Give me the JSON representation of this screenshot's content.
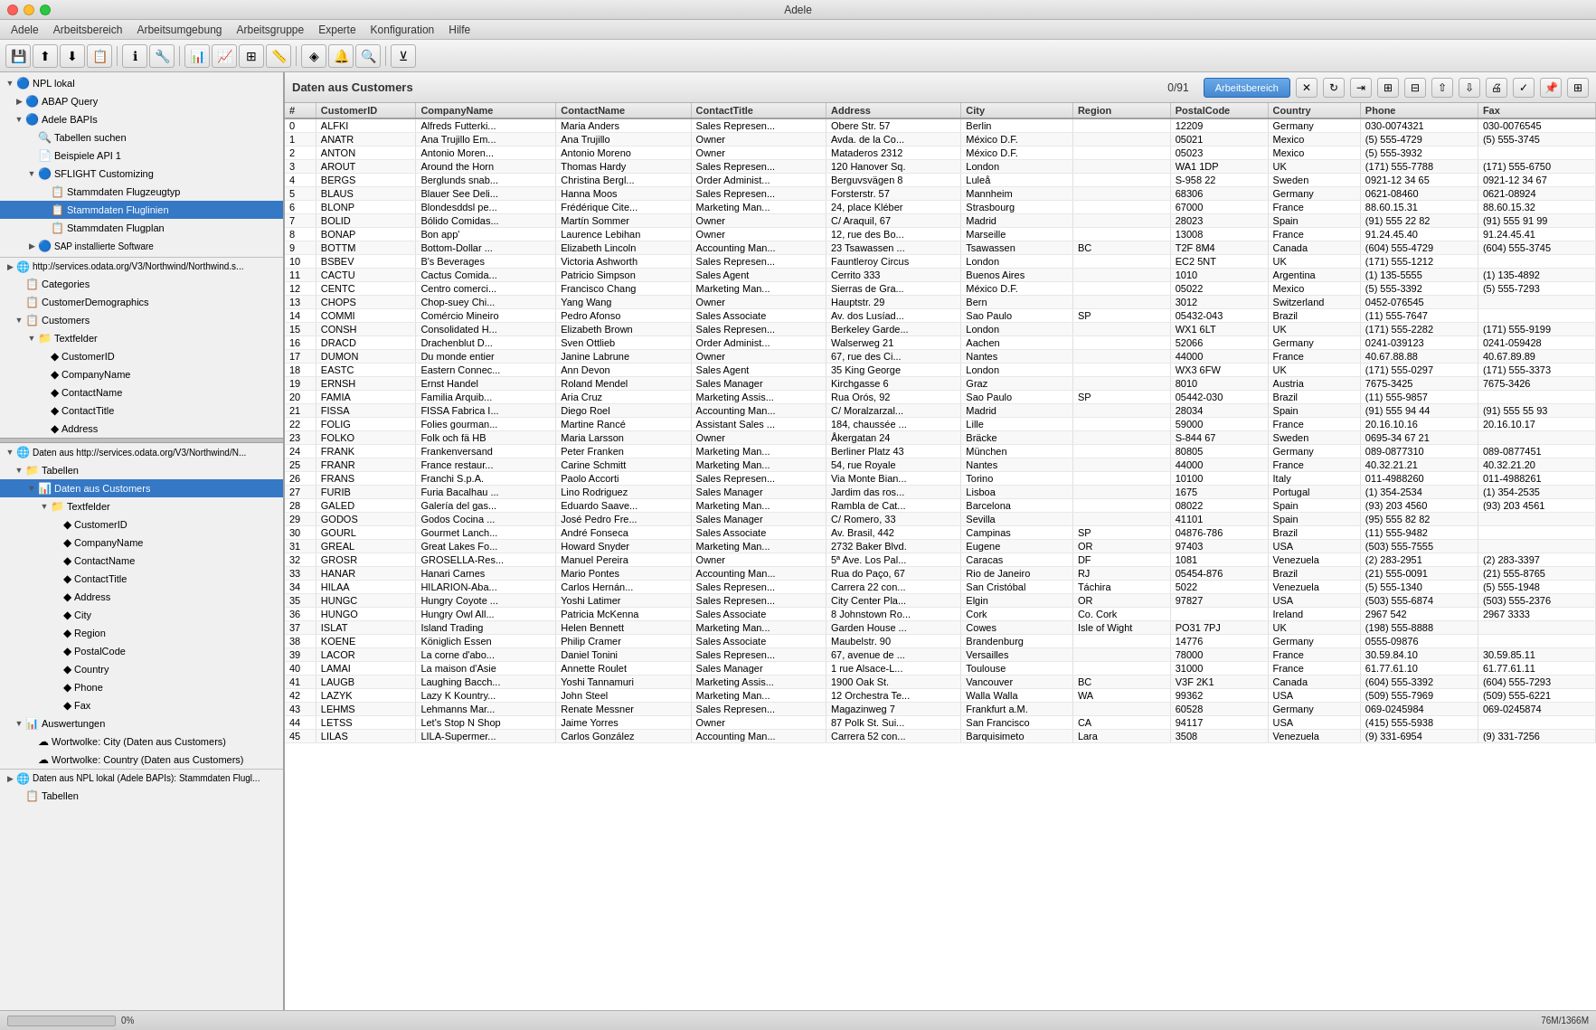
{
  "app": {
    "title": "Adele"
  },
  "menubar": {
    "items": [
      {
        "label": "Adele"
      },
      {
        "label": "Arbeitsbereich"
      },
      {
        "label": "Arbeitsumgebung"
      },
      {
        "label": "Arbeitsgruppe"
      },
      {
        "label": "Experte"
      },
      {
        "label": "Konfiguration"
      },
      {
        "label": "Hilfe"
      }
    ]
  },
  "data_header": {
    "title": "Daten aus Customers",
    "count": "0/91",
    "arbeitsbereich_label": "Arbeitsbereich"
  },
  "table": {
    "columns": [
      "#",
      "CustomerID",
      "CompanyName",
      "ContactName",
      "ContactTitle",
      "Address",
      "City",
      "Region",
      "PostalCode",
      "Country",
      "Phone",
      "Fax"
    ],
    "rows": [
      [
        0,
        "ALFKI",
        "Alfreds Futterki...",
        "Maria Anders",
        "Sales Represen...",
        "Obere Str. 57",
        "Berlin",
        "",
        "12209",
        "Germany",
        "030-0074321",
        "030-0076545"
      ],
      [
        1,
        "ANATR",
        "Ana Trujillo Em...",
        "Ana Trujillo",
        "Owner",
        "Avda. de la Co...",
        "México D.F.",
        "",
        "05021",
        "Mexico",
        "(5) 555-4729",
        "(5) 555-3745"
      ],
      [
        2,
        "ANTON",
        "Antonio Moren...",
        "Antonio Moreno",
        "Owner",
        "Mataderos 2312",
        "México D.F.",
        "",
        "05023",
        "Mexico",
        "(5) 555-3932",
        ""
      ],
      [
        3,
        "AROUT",
        "Around the Horn",
        "Thomas Hardy",
        "Sales Represen...",
        "120 Hanover Sq.",
        "London",
        "",
        "WA1 1DP",
        "UK",
        "(171) 555-7788",
        "(171) 555-6750"
      ],
      [
        4,
        "BERGS",
        "Berglunds snab...",
        "Christina Bergl...",
        "Order Administ...",
        "Berguvsvägen 8",
        "Luleå",
        "",
        "S-958 22",
        "Sweden",
        "0921-12 34 65",
        "0921-12 34 67"
      ],
      [
        5,
        "BLAUS",
        "Blauer See Deli...",
        "Hanna Moos",
        "Sales Represen...",
        "Forsterstr. 57",
        "Mannheim",
        "",
        "68306",
        "Germany",
        "0621-08460",
        "0621-08924"
      ],
      [
        6,
        "BLONP",
        "Blondesddsl pe...",
        "Frédérique Cite...",
        "Marketing Man...",
        "24, place Kléber",
        "Strasbourg",
        "",
        "67000",
        "France",
        "88.60.15.31",
        "88.60.15.32"
      ],
      [
        7,
        "BOLID",
        "Bólido Comidas...",
        "Martín Sommer",
        "Owner",
        "C/ Araquil, 67",
        "Madrid",
        "",
        "28023",
        "Spain",
        "(91) 555 22 82",
        "(91) 555 91 99"
      ],
      [
        8,
        "BONAP",
        "Bon app'",
        "Laurence Lebihan",
        "Owner",
        "12, rue des Bo...",
        "Marseille",
        "",
        "13008",
        "France",
        "91.24.45.40",
        "91.24.45.41"
      ],
      [
        9,
        "BOTTM",
        "Bottom-Dollar ...",
        "Elizabeth Lincoln",
        "Accounting Man...",
        "23 Tsawassen ...",
        "Tsawassen",
        "BC",
        "T2F 8M4",
        "Canada",
        "(604) 555-4729",
        "(604) 555-3745"
      ],
      [
        10,
        "BSBEV",
        "B's Beverages",
        "Victoria Ashworth",
        "Sales Represen...",
        "Fauntleroy Circus",
        "London",
        "",
        "EC2 5NT",
        "UK",
        "(171) 555-1212",
        ""
      ],
      [
        11,
        "CACTU",
        "Cactus Comida...",
        "Patricio Simpson",
        "Sales Agent",
        "Cerrito 333",
        "Buenos Aires",
        "",
        "1010",
        "Argentina",
        "(1) 135-5555",
        "(1) 135-4892"
      ],
      [
        12,
        "CENTC",
        "Centro comerci...",
        "Francisco Chang",
        "Marketing Man...",
        "Sierras de Gra...",
        "México D.F.",
        "",
        "05022",
        "Mexico",
        "(5) 555-3392",
        "(5) 555-7293"
      ],
      [
        13,
        "CHOPS",
        "Chop-suey Chi...",
        "Yang Wang",
        "Owner",
        "Hauptstr. 29",
        "Bern",
        "",
        "3012",
        "Switzerland",
        "0452-076545",
        ""
      ],
      [
        14,
        "COMMI",
        "Comércio Mineiro",
        "Pedro Afonso",
        "Sales Associate",
        "Av. dos Lusíad...",
        "Sao Paulo",
        "SP",
        "05432-043",
        "Brazil",
        "(11) 555-7647",
        ""
      ],
      [
        15,
        "CONSH",
        "Consolidated H...",
        "Elizabeth Brown",
        "Sales Represen...",
        "Berkeley Garde...",
        "London",
        "",
        "WX1 6LT",
        "UK",
        "(171) 555-2282",
        "(171) 555-9199"
      ],
      [
        16,
        "DRACD",
        "Drachenblut D...",
        "Sven Ottlieb",
        "Order Administ...",
        "Walserweg 21",
        "Aachen",
        "",
        "52066",
        "Germany",
        "0241-039123",
        "0241-059428"
      ],
      [
        17,
        "DUMON",
        "Du monde entier",
        "Janine Labrune",
        "Owner",
        "67, rue des Ci...",
        "Nantes",
        "",
        "44000",
        "France",
        "40.67.88.88",
        "40.67.89.89"
      ],
      [
        18,
        "EASTC",
        "Eastern Connec...",
        "Ann Devon",
        "Sales Agent",
        "35 King George",
        "London",
        "",
        "WX3 6FW",
        "UK",
        "(171) 555-0297",
        "(171) 555-3373"
      ],
      [
        19,
        "ERNSH",
        "Ernst Handel",
        "Roland Mendel",
        "Sales Manager",
        "Kirchgasse 6",
        "Graz",
        "",
        "8010",
        "Austria",
        "7675-3425",
        "7675-3426"
      ],
      [
        20,
        "FAMIA",
        "Familia Arquib...",
        "Aria Cruz",
        "Marketing Assis...",
        "Rua Orós, 92",
        "Sao Paulo",
        "SP",
        "05442-030",
        "Brazil",
        "(11) 555-9857",
        ""
      ],
      [
        21,
        "FISSA",
        "FISSA Fabrica I...",
        "Diego Roel",
        "Accounting Man...",
        "C/ Moralzarzal...",
        "Madrid",
        "",
        "28034",
        "Spain",
        "(91) 555 94 44",
        "(91) 555 55 93"
      ],
      [
        22,
        "FOLIG",
        "Folies gourman...",
        "Martine Rancé",
        "Assistant Sales ...",
        "184, chaussée ...",
        "Lille",
        "",
        "59000",
        "France",
        "20.16.10.16",
        "20.16.10.17"
      ],
      [
        23,
        "FOLKO",
        "Folk och fä HB",
        "Maria Larsson",
        "Owner",
        "Åkergatan 24",
        "Bräcke",
        "",
        "S-844 67",
        "Sweden",
        "0695-34 67 21",
        ""
      ],
      [
        24,
        "FRANK",
        "Frankenversand",
        "Peter Franken",
        "Marketing Man...",
        "Berliner Platz 43",
        "München",
        "",
        "80805",
        "Germany",
        "089-0877310",
        "089-0877451"
      ],
      [
        25,
        "FRANR",
        "France restaur...",
        "Carine Schmitt",
        "Marketing Man...",
        "54, rue Royale",
        "Nantes",
        "",
        "44000",
        "France",
        "40.32.21.21",
        "40.32.21.20"
      ],
      [
        26,
        "FRANS",
        "Franchi S.p.A.",
        "Paolo Accorti",
        "Sales Represen...",
        "Via Monte Bian...",
        "Torino",
        "",
        "10100",
        "Italy",
        "011-4988260",
        "011-4988261"
      ],
      [
        27,
        "FURIB",
        "Furia Bacalhau ...",
        "Lino Rodriguez",
        "Sales Manager",
        "Jardim das ros...",
        "Lisboa",
        "",
        "1675",
        "Portugal",
        "(1) 354-2534",
        "(1) 354-2535"
      ],
      [
        28,
        "GALED",
        "Galería del gas...",
        "Eduardo Saave...",
        "Marketing Man...",
        "Rambla de Cat...",
        "Barcelona",
        "",
        "08022",
        "Spain",
        "(93) 203 4560",
        "(93) 203 4561"
      ],
      [
        29,
        "GODOS",
        "Godos Cocina ...",
        "José Pedro Fre...",
        "Sales Manager",
        "C/ Romero, 33",
        "Sevilla",
        "",
        "41101",
        "Spain",
        "(95) 555 82 82",
        ""
      ],
      [
        30,
        "GOURL",
        "Gourmet Lanch...",
        "André Fonseca",
        "Sales Associate",
        "Av. Brasil, 442",
        "Campinas",
        "SP",
        "04876-786",
        "Brazil",
        "(11) 555-9482",
        ""
      ],
      [
        31,
        "GREAL",
        "Great Lakes Fo...",
        "Howard Snyder",
        "Marketing Man...",
        "2732 Baker Blvd.",
        "Eugene",
        "OR",
        "97403",
        "USA",
        "(503) 555-7555",
        ""
      ],
      [
        32,
        "GROSR",
        "GROSELLA-Res...",
        "Manuel Pereira",
        "Owner",
        "5ª Ave. Los Pal...",
        "Caracas",
        "DF",
        "1081",
        "Venezuela",
        "(2) 283-2951",
        "(2) 283-3397"
      ],
      [
        33,
        "HANAR",
        "Hanari Carnes",
        "Mario Pontes",
        "Accounting Man...",
        "Rua do Paço, 67",
        "Rio de Janeiro",
        "RJ",
        "05454-876",
        "Brazil",
        "(21) 555-0091",
        "(21) 555-8765"
      ],
      [
        34,
        "HILAA",
        "HILARION-Aba...",
        "Carlos Hernán...",
        "Sales Represen...",
        "Carrera 22 con...",
        "San Cristóbal",
        "Táchira",
        "5022",
        "Venezuela",
        "(5) 555-1340",
        "(5) 555-1948"
      ],
      [
        35,
        "HUNGC",
        "Hungry Coyote ...",
        "Yoshi Latimer",
        "Sales Represen...",
        "City Center Pla...",
        "Elgin",
        "OR",
        "97827",
        "USA",
        "(503) 555-6874",
        "(503) 555-2376"
      ],
      [
        36,
        "HUNGO",
        "Hungry Owl All...",
        "Patricia McKenna",
        "Sales Associate",
        "8 Johnstown Ro...",
        "Cork",
        "Co. Cork",
        "",
        "Ireland",
        "2967 542",
        "2967 3333"
      ],
      [
        37,
        "ISLAT",
        "Island Trading",
        "Helen Bennett",
        "Marketing Man...",
        "Garden House ...",
        "Cowes",
        "Isle of Wight",
        "PO31 7PJ",
        "UK",
        "(198) 555-8888",
        ""
      ],
      [
        38,
        "KOENE",
        "Königlich Essen",
        "Philip Cramer",
        "Sales Associate",
        "Maubelstr. 90",
        "Brandenburg",
        "",
        "14776",
        "Germany",
        "0555-09876",
        ""
      ],
      [
        39,
        "LACOR",
        "La corne d'abo...",
        "Daniel Tonini",
        "Sales Represen...",
        "67, avenue de ...",
        "Versailles",
        "",
        "78000",
        "France",
        "30.59.84.10",
        "30.59.85.11"
      ],
      [
        40,
        "LAMAI",
        "La maison d'Asie",
        "Annette Roulet",
        "Sales Manager",
        "1 rue Alsace-L...",
        "Toulouse",
        "",
        "31000",
        "France",
        "61.77.61.10",
        "61.77.61.11"
      ],
      [
        41,
        "LAUGB",
        "Laughing Bacch...",
        "Yoshi Tannamuri",
        "Marketing Assis...",
        "1900 Oak St.",
        "Vancouver",
        "BC",
        "V3F 2K1",
        "Canada",
        "(604) 555-3392",
        "(604) 555-7293"
      ],
      [
        42,
        "LAZYK",
        "Lazy K Kountry...",
        "John Steel",
        "Marketing Man...",
        "12 Orchestra Te...",
        "Walla Walla",
        "WA",
        "99362",
        "USA",
        "(509) 555-7969",
        "(509) 555-6221"
      ],
      [
        43,
        "LEHMS",
        "Lehmanns Mar...",
        "Renate Messner",
        "Sales Represen...",
        "Magazinweg 7",
        "Frankfurt a.M.",
        "",
        "60528",
        "Germany",
        "069-0245984",
        "069-0245874"
      ],
      [
        44,
        "LETSS",
        "Let's Stop N Shop",
        "Jaime Yorres",
        "Owner",
        "87 Polk St. Sui...",
        "San Francisco",
        "CA",
        "94117",
        "USA",
        "(415) 555-5938",
        ""
      ],
      [
        45,
        "LILAS",
        "LILA-Supermer...",
        "Carlos González",
        "Accounting Man...",
        "Carrera 52 con...",
        "Barquisimeto",
        "Lara",
        "3508",
        "Venezuela",
        "(9) 331-6954",
        "(9) 331-7256"
      ]
    ]
  },
  "left_tree": {
    "sections": [
      {
        "label": "NPL lokal",
        "indent": 0,
        "expanded": true,
        "icon": "🔵"
      },
      {
        "label": "ABAP Query",
        "indent": 1,
        "expanded": false,
        "icon": "▶"
      },
      {
        "label": "Adele BAPIs",
        "indent": 1,
        "expanded": true,
        "icon": "▼"
      },
      {
        "label": "Tabellen suchen",
        "indent": 2,
        "icon": "🔍"
      },
      {
        "label": "Beispiele API 1",
        "indent": 2,
        "icon": "📄"
      },
      {
        "label": "SFLIGHT Customizing",
        "indent": 2,
        "expanded": true,
        "icon": "▼"
      },
      {
        "label": "Stammdaten Flugzeugtyp",
        "indent": 3,
        "icon": "📋"
      },
      {
        "label": "Stammdaten Fluglinien",
        "indent": 3,
        "selected": true,
        "icon": "📋"
      },
      {
        "label": "Stammdaten Flugplan",
        "indent": 3,
        "icon": "📋"
      },
      {
        "label": "SAP installierte Software",
        "indent": 2,
        "icon": "▶"
      },
      {
        "label": "http://services.odata.org/V3/Northwind/Northwind.s...",
        "indent": 0,
        "icon": "🌐"
      },
      {
        "label": "Categories",
        "indent": 1,
        "icon": "📋"
      },
      {
        "label": "CustomerDemographics",
        "indent": 1,
        "icon": "📋"
      },
      {
        "label": "Customers",
        "indent": 1,
        "expanded": true,
        "icon": "▼"
      },
      {
        "label": "Textfelder",
        "indent": 2,
        "expanded": true,
        "icon": "▼"
      },
      {
        "label": "CustomerID",
        "indent": 3,
        "icon": "◆"
      },
      {
        "label": "CompanyName",
        "indent": 3,
        "icon": "◆"
      },
      {
        "label": "ContactName",
        "indent": 3,
        "icon": "◆"
      },
      {
        "label": "ContactTitle",
        "indent": 3,
        "icon": "◆"
      },
      {
        "label": "Address",
        "indent": 3,
        "icon": "◆"
      }
    ]
  },
  "left_tree2": {
    "sections": [
      {
        "label": "Daten aus http://services.odata.org/V3/Northwind/N...",
        "indent": 0,
        "icon": "🌐"
      },
      {
        "label": "Tabellen",
        "indent": 1,
        "expanded": true,
        "icon": "▼"
      },
      {
        "label": "Daten aus Customers",
        "indent": 2,
        "selected": true,
        "icon": "📊"
      },
      {
        "label": "Textfelder",
        "indent": 3,
        "expanded": true,
        "icon": "▼"
      },
      {
        "label": "CustomerID",
        "indent": 4,
        "icon": "◆"
      },
      {
        "label": "CompanyName",
        "indent": 4,
        "icon": "◆"
      },
      {
        "label": "ContactName",
        "indent": 4,
        "icon": "◆"
      },
      {
        "label": "ContactTitle",
        "indent": 4,
        "icon": "◆"
      },
      {
        "label": "Address",
        "indent": 4,
        "icon": "◆"
      },
      {
        "label": "City",
        "indent": 4,
        "icon": "◆"
      },
      {
        "label": "Region",
        "indent": 4,
        "icon": "◆"
      },
      {
        "label": "PostalCode",
        "indent": 4,
        "icon": "◆"
      },
      {
        "label": "Country",
        "indent": 4,
        "icon": "◆"
      },
      {
        "label": "Phone",
        "indent": 4,
        "icon": "◆"
      },
      {
        "label": "Fax",
        "indent": 4,
        "icon": "◆"
      }
    ]
  },
  "left_tree3": {
    "sections": [
      {
        "label": "Auswertungen",
        "indent": 1,
        "expanded": true,
        "icon": "▼"
      },
      {
        "label": "Wortwolke: City (Daten aus Customers)",
        "indent": 2,
        "icon": "☁"
      },
      {
        "label": "Wortwolke: Country (Daten aus Customers)",
        "indent": 2,
        "icon": "☁"
      },
      {
        "label": "Daten aus NPL lokal (Adele BAPIs): Stammdaten Flugl...",
        "indent": 0,
        "icon": "🌐"
      },
      {
        "label": "Tabellen",
        "indent": 1,
        "icon": "📋"
      }
    ]
  },
  "status": {
    "progress_percent": 0,
    "progress_label": "0%",
    "memory": "76M/1366M"
  },
  "toolbar_icons": [
    "💾",
    "📤",
    "📥",
    "📋",
    "ℹ",
    "🔧",
    "📊",
    "📈",
    "🔲",
    "📐",
    "🔷",
    "🔔",
    "🔍"
  ]
}
